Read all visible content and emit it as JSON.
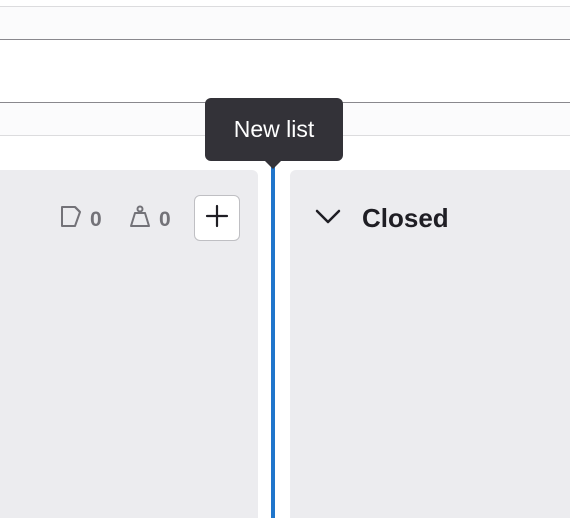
{
  "tooltip": {
    "text": "New list"
  },
  "left_list": {
    "issue_count": "0",
    "weight_count": "0",
    "icons": {
      "issues": "issue-icon",
      "weight": "weight-icon",
      "add": "plus-icon"
    }
  },
  "right_list": {
    "title": "Closed",
    "icons": {
      "toggle": "chevron-down-icon"
    }
  },
  "colors": {
    "accent": "#1f75cb",
    "tooltip_bg": "#333238",
    "list_bg": "#ececef",
    "muted_text": "#737278",
    "title_text": "#1f1e24"
  }
}
